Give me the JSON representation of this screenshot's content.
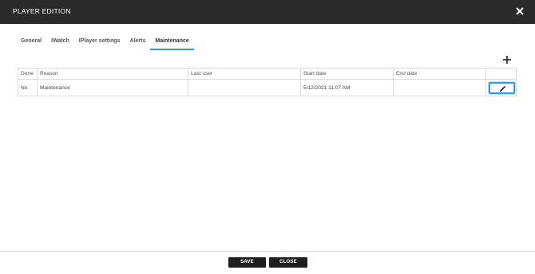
{
  "dialog": {
    "title": "PLAYER EDITION"
  },
  "tabs": [
    {
      "label": "General",
      "active": false
    },
    {
      "label": "IWatch",
      "active": false
    },
    {
      "label": "IPlayer settings",
      "active": false
    },
    {
      "label": "Alerts",
      "active": false
    },
    {
      "label": "Maintenance",
      "active": true
    }
  ],
  "table": {
    "headers": [
      "Done",
      "Reason",
      "Last user",
      "Start date",
      "End date",
      ""
    ],
    "rows": [
      {
        "done": "No",
        "reason": "Maintenance",
        "last_user": "",
        "start_date": "5/12/2021 11:07 AM",
        "end_date": ""
      }
    ]
  },
  "footer": {
    "save_label": "SAVE",
    "close_label": "CLOSE"
  },
  "colors": {
    "titlebar": "#2b2b2b",
    "accent": "#3a9ad9",
    "button": "#1f1f1f"
  },
  "icons": {
    "close": "close-icon",
    "add": "plus-icon",
    "edit": "pencil-icon"
  }
}
